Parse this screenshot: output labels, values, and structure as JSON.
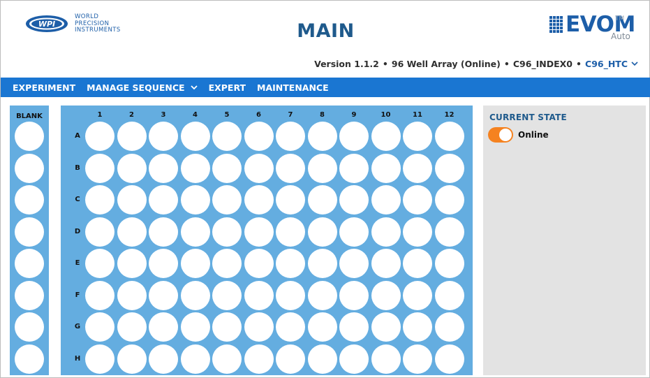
{
  "header": {
    "brand_lines": [
      "WORLD",
      "PRECISION",
      "INSTRUMENTS"
    ],
    "logo_text": "WPI",
    "page_title": "MAIN",
    "product": {
      "name": "EVOM",
      "trademark": "TM",
      "edition": "Auto"
    }
  },
  "status": {
    "version": "Version 1.1.2",
    "separator": "•",
    "array_mode": "96 Well Array (Online)",
    "index": "C96_INDEX0",
    "device": "C96_HTC"
  },
  "nav": {
    "items": [
      {
        "label": "EXPERIMENT"
      },
      {
        "label": "MANAGE SEQUENCE",
        "has_dropdown": true
      },
      {
        "label": "EXPERT"
      },
      {
        "label": "MAINTENANCE"
      }
    ]
  },
  "plate": {
    "blank_label": "BLANK",
    "columns": [
      "1",
      "2",
      "3",
      "4",
      "5",
      "6",
      "7",
      "8",
      "9",
      "10",
      "11",
      "12"
    ],
    "rows": [
      "A",
      "B",
      "C",
      "D",
      "E",
      "F",
      "G",
      "H"
    ]
  },
  "current_state": {
    "title": "CURRENT STATE",
    "toggle_label": "Online",
    "toggle_on": true
  },
  "colors": {
    "nav_bar": "#1a76d2",
    "plate_bg": "#64ade0",
    "title": "#1f5a8c",
    "brand_blue": "#1d5ea8",
    "toggle_on": "#f58220",
    "state_panel": "#e3e3e3"
  },
  "icons": [
    "wpi-logo",
    "evom-logo-grid",
    "chevron-down-icon",
    "toggle-switch"
  ]
}
